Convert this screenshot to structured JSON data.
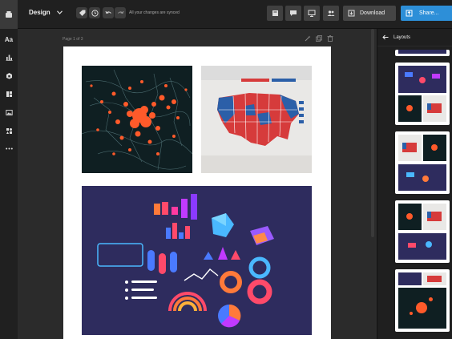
{
  "topbar": {
    "menu_label": "Design",
    "saved_status": "All your changes are synced",
    "download_label": "Download",
    "share_label": "Share..."
  },
  "canvas": {
    "page_label": "Page 1 of 3"
  },
  "layouts_panel": {
    "title": "Layouts"
  },
  "colors": {
    "accent": "#2d8fd8",
    "map_dots": "#ff5a2a",
    "us_red": "#d63b3b",
    "us_blue": "#2b5fa8"
  },
  "icons": [
    "logo-icon",
    "chevron-down-icon",
    "tag-icon",
    "clock-icon",
    "undo-icon",
    "redo-icon",
    "note-icon",
    "comment-icon",
    "present-icon",
    "people-icon",
    "download-icon",
    "share-icon",
    "text-icon",
    "chart-icon",
    "elements-icon",
    "layout-icon",
    "image-icon",
    "shapes-icon",
    "more-icon",
    "back-arrow-icon",
    "magic-icon",
    "copy-icon",
    "trash-icon"
  ]
}
